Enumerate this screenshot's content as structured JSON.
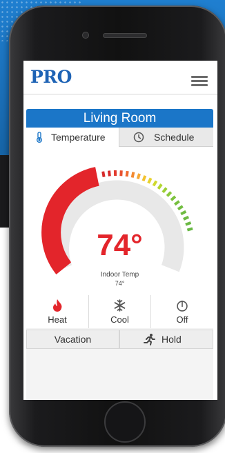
{
  "app": {
    "logo_text": "PRO",
    "brand_color": "#1e63b5"
  },
  "room": {
    "name": "Living Room",
    "header_color": "#1b76c8"
  },
  "tabs": [
    {
      "label": "Temperature",
      "icon": "thermometer-icon",
      "active": true
    },
    {
      "label": "Schedule",
      "icon": "clock-icon",
      "active": false
    }
  ],
  "thermostat": {
    "setpoint_display": "74°",
    "indoor_label": "Indoor Temp",
    "indoor_value": "74°",
    "setpoint_color": "#e3252b"
  },
  "modes": [
    {
      "label": "Heat",
      "icon": "flame-icon",
      "selected": true
    },
    {
      "label": "Cool",
      "icon": "snowflake-icon",
      "selected": false
    },
    {
      "label": "Off",
      "icon": "power-icon",
      "selected": false
    }
  ],
  "actions": {
    "vacation_label": "Vacation",
    "hold_label": "Hold",
    "hold_icon": "running-person-icon"
  }
}
